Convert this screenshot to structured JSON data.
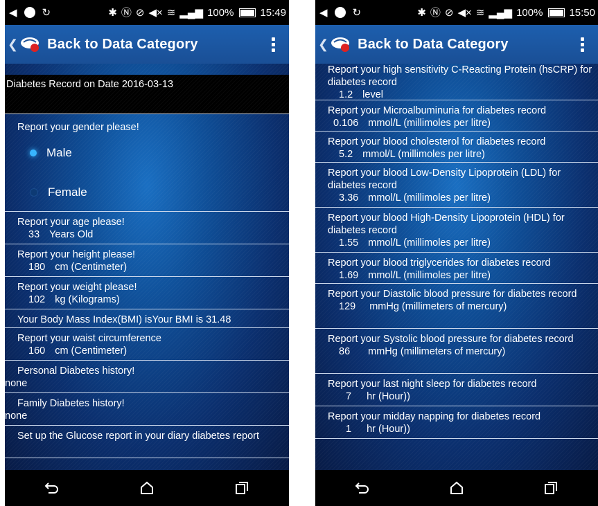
{
  "left": {
    "status": {
      "battery": "100%",
      "time": "15:49"
    },
    "appbar": {
      "title": "Back to Data Category"
    },
    "header": "Diabetes Record on Date 2016-03-13",
    "gender": {
      "label": "Report your gender please!",
      "options": [
        "Male",
        "Female"
      ],
      "selected": "Male"
    },
    "rows": [
      {
        "label": "Report your age please!",
        "value": "33",
        "unit": "Years Old"
      },
      {
        "label": "Report your height please!",
        "value": "180",
        "unit": "cm (Centimeter)"
      },
      {
        "label": "Report your weight please!",
        "value": "102",
        "unit": "kg (Kilograms)"
      },
      {
        "label": "Your Body Mass Index(BMI) isYour BMI is 31.48"
      },
      {
        "label": "Report your waist circumference",
        "value": "160",
        "unit": "cm (Centimeter)"
      },
      {
        "label": "Personal Diabetes history!",
        "text": "none"
      },
      {
        "label": "Family Diabetes history!",
        "text": "none"
      },
      {
        "label": "Set up the Glucose report in your diary diabetes report"
      }
    ]
  },
  "right": {
    "status": {
      "battery": "100%",
      "time": "15:50"
    },
    "appbar": {
      "title": "Back to Data Category"
    },
    "rows": [
      {
        "label": "Report your high sensitivity C-Reacting Protein (hsCRP) for diabetes record",
        "value": "1.2",
        "unit": "level"
      },
      {
        "label": "Report your Microalbuminuria for diabetes record",
        "value": "0.106",
        "unit": "mmol/L  (millimoles per litre)"
      },
      {
        "label": "Report your blood cholesterol for diabetes record",
        "value": "5.2",
        "unit": "mmol/L  (millimoles per litre)"
      },
      {
        "label": "Report your blood Low-Density Lipoprotein (LDL) for diabetes record",
        "value": "3.36",
        "unit": "mmol/L  (millimoles per litre)"
      },
      {
        "label": "Report your blood High-Density Lipoprotein (HDL) for diabetes record",
        "value": "1.55",
        "unit": "mmol/L  (millimoles per litre)"
      },
      {
        "label": "Report your blood triglycerides for diabetes record",
        "value": "1.69",
        "unit": "mmol/L  (millimoles per litre)"
      },
      {
        "label": "Report your Diastolic blood pressure for diabetes record",
        "value": "129",
        "unit": "mmHg (millimeters of mercury)"
      },
      {
        "label": "Report your Systolic blood pressure for diabetes record",
        "value": "86",
        "unit": "mmHg (millimeters of mercury)"
      },
      {
        "label": "Report your last night sleep for diabetes record",
        "value": "7",
        "unit": "hr (Hour))"
      },
      {
        "label": "Report your midday napping for diabetes record",
        "value": "1",
        "unit": "hr (Hour))"
      }
    ]
  }
}
